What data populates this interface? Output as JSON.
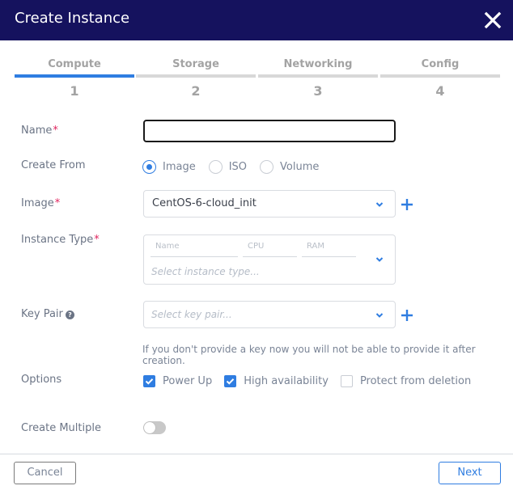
{
  "dialog": {
    "title": "Create Instance",
    "close_icon": "close-icon"
  },
  "steps": [
    {
      "label": "Compute",
      "number": "1",
      "active": true
    },
    {
      "label": "Storage",
      "number": "2",
      "active": false
    },
    {
      "label": "Networking",
      "number": "3",
      "active": false
    },
    {
      "label": "Config",
      "number": "4",
      "active": false
    }
  ],
  "form": {
    "name": {
      "label": "Name",
      "required": "*",
      "value": ""
    },
    "create_from": {
      "label": "Create From",
      "options": [
        "Image",
        "ISO",
        "Volume"
      ],
      "selected": "Image"
    },
    "image": {
      "label": "Image",
      "required": "*",
      "value": "CentOS-6-cloud_init",
      "add_icon": "plus-icon"
    },
    "instance_type": {
      "label": "Instance Type",
      "required": "*",
      "columns": [
        "Name",
        "CPU",
        "RAM"
      ],
      "placeholder": "Select instance type..."
    },
    "key_pair": {
      "label": "Key Pair",
      "help_icon": "question-circle-icon",
      "help_glyph": "?",
      "placeholder": "Select key pair...",
      "add_icon": "plus-icon",
      "hint": "If you don't provide a key now you will not be able to provide it after creation."
    },
    "options": {
      "label": "Options",
      "items": [
        {
          "label": "Power Up",
          "checked": true
        },
        {
          "label": "High availability",
          "checked": true
        },
        {
          "label": "Protect from deletion",
          "checked": false
        }
      ]
    },
    "create_multiple": {
      "label": "Create Multiple",
      "enabled": false
    }
  },
  "footer": {
    "cancel_label": "Cancel",
    "next_label": "Next"
  },
  "colors": {
    "header_bg": "#15125e",
    "accent": "#2f7de1",
    "required": "#e0245e"
  }
}
